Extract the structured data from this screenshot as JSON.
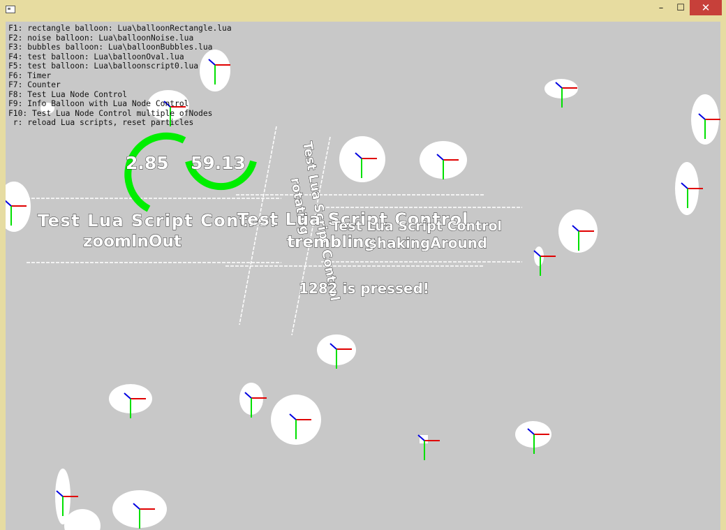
{
  "window": {
    "title": "",
    "controls": {
      "minimize": "–",
      "maximize": "☐",
      "close": "✕"
    }
  },
  "help_lines": [
    "F1: rectangle balloon: Lua\\balloonRectangle.lua",
    "F2: noise balloon: Lua\\balloonNoise.lua",
    "F3: bubbles balloon: Lua\\balloonBubbles.lua",
    "F4: test balloon: Lua\\balloonOval.lua",
    "F5: test balloon: Lua\\balloonscript0.lua",
    "F6: Timer",
    "F7: Counter",
    "F8: Test Lua Node Control",
    "F9: Info Balloon with Lua Node Control",
    "F10: Test Lua Node Control multiple ofNodes",
    " r: reload Lua scripts, reset particles"
  ],
  "timer": {
    "left_value": "2.85",
    "right_value": "59.13"
  },
  "controls": {
    "zoom_title": "Test Lua Script Control",
    "zoom_subtitle": "zoomInOut",
    "trembling_title": "Test Lua Script Control",
    "trembling_subtitle": "trembling",
    "shaking_title": "Test Lua Script Control",
    "shaking_subtitle": "shakingAround",
    "rotating_title": "Test Lua Script Control",
    "rotating_subtitle": "rotating"
  },
  "key_status": "1282 is pressed!",
  "colors": {
    "axis_x": "#e00000",
    "axis_y": "#00e000",
    "axis_z": "#0000e0",
    "timer_arc": "#00ee00",
    "background": "#c8c8c8"
  }
}
